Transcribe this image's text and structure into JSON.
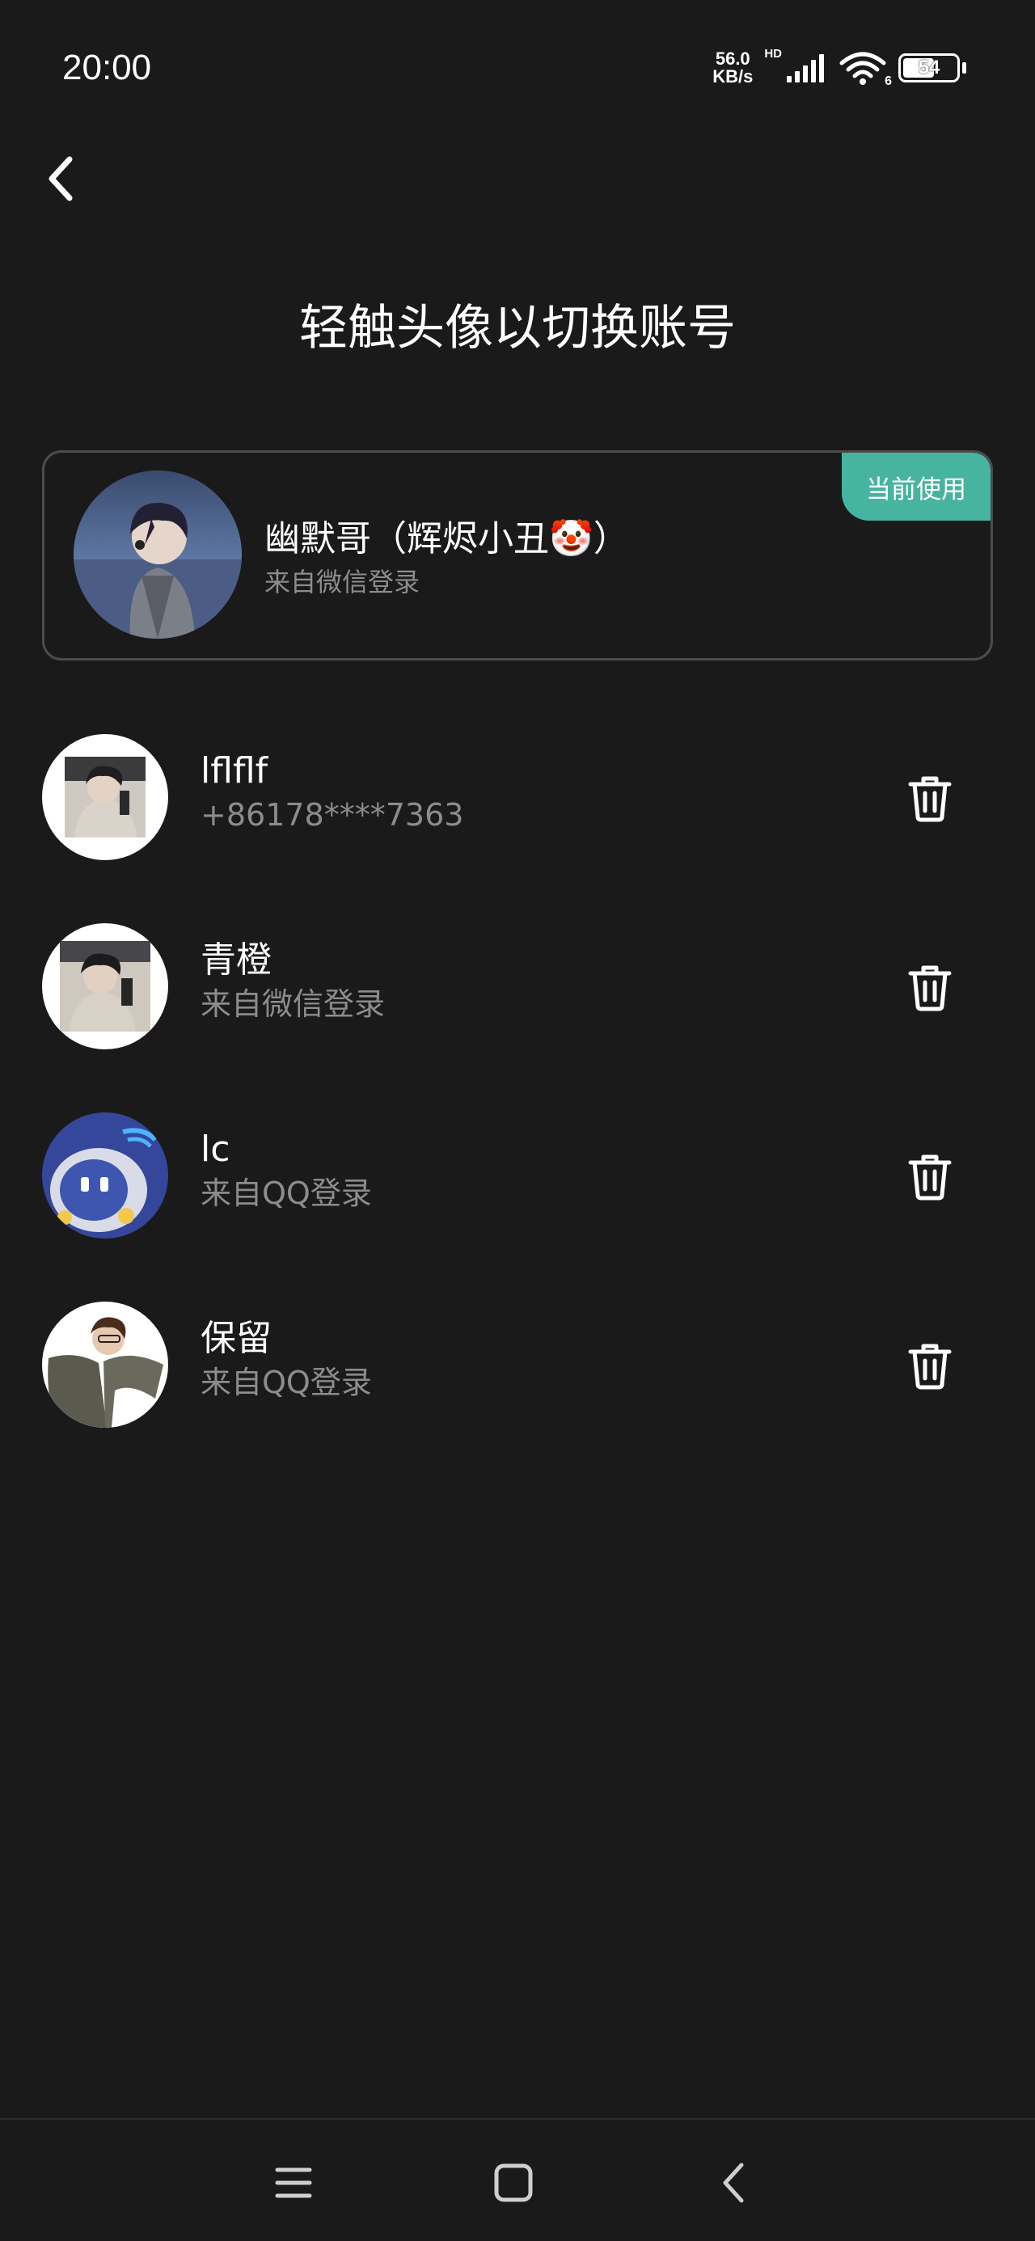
{
  "status_bar": {
    "time": "20:00",
    "net_speed_value": "56.0",
    "net_speed_unit": "KB/s",
    "network_badge": "HD",
    "wifi_badge": "6",
    "battery_level": "54"
  },
  "header": {
    "back_icon": "chevron-left-icon",
    "title": "轻触头像以切换账号"
  },
  "current_account": {
    "badge": "当前使用",
    "name": "幽默哥（辉烬小丑🤡）",
    "source": "来自微信登录"
  },
  "accounts": [
    {
      "name": "lflflf",
      "source": "+86178****7363",
      "avatar_style": "photo-boy"
    },
    {
      "name": "青橙",
      "source": "来自微信登录",
      "avatar_style": "photo-boy"
    },
    {
      "name": "lc",
      "source": "来自QQ登录",
      "avatar_style": "robot"
    },
    {
      "name": "保留",
      "source": "来自QQ登录",
      "avatar_style": "illustration"
    }
  ],
  "icons": {
    "delete": "trash-icon",
    "nav_menu": "menu-icon",
    "nav_home": "home-square-icon",
    "nav_back": "back-chevron-icon"
  },
  "colors": {
    "background": "#1a1a1b",
    "accent": "#47b4a0",
    "secondary_text": "#8c8c8f",
    "card_border": "#4c4c4e"
  }
}
